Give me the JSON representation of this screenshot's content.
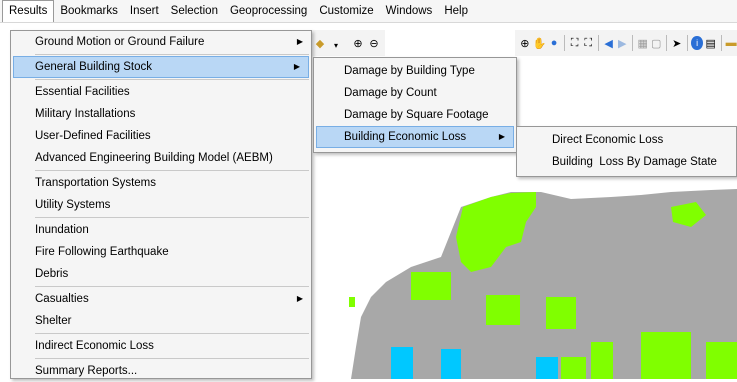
{
  "menubar": [
    "Results",
    "Bookmarks",
    "Insert",
    "Selection",
    "Geoprocessing",
    "Customize",
    "Windows",
    "Help"
  ],
  "results_menu": {
    "items": [
      {
        "label": "Ground Motion or Ground Failure",
        "submenu": true
      },
      {
        "label": "General Building Stock",
        "submenu": true,
        "highlighted": true
      },
      {
        "label": "Essential Facilities"
      },
      {
        "label": "Military Installations"
      },
      {
        "label": "User-Defined Facilities"
      },
      {
        "label": "Advanced Engineering Building Model (AEBM)"
      },
      {
        "label": "Transportation Systems"
      },
      {
        "label": "Utility Systems"
      },
      {
        "label": "Inundation"
      },
      {
        "label": "Fire Following Earthquake"
      },
      {
        "label": "Debris"
      },
      {
        "label": "Casualties",
        "submenu": true
      },
      {
        "label": "Shelter"
      },
      {
        "label": "Indirect Economic Loss"
      },
      {
        "label": "Summary Reports..."
      }
    ]
  },
  "gbs_menu": {
    "items": [
      {
        "label": "Damage by Building Type"
      },
      {
        "label": "Damage by Count"
      },
      {
        "label": "Damage by Square Footage"
      },
      {
        "label": "Building Economic Loss",
        "submenu": true,
        "highlighted": true
      }
    ]
  },
  "loss_menu": {
    "items": [
      {
        "label": "Direct Economic Loss"
      },
      {
        "label": "Building  Loss By Damage State"
      }
    ]
  },
  "colors": {
    "map_gray": "#a8a8a8",
    "map_green": "#80ff00",
    "map_cyan": "#00c8ff",
    "highlight": "#b9d7f5"
  },
  "toolbar_icons": [
    "zoom-in-icon",
    "zoom-out-icon",
    "zoom-extent-icon",
    "pan-icon",
    "globe-icon",
    "full-extent-icon",
    "fixed-zoom-icon",
    "back-icon",
    "forward-icon",
    "select-icon",
    "identify-icon",
    "html-popup-icon",
    "measure-icon"
  ]
}
